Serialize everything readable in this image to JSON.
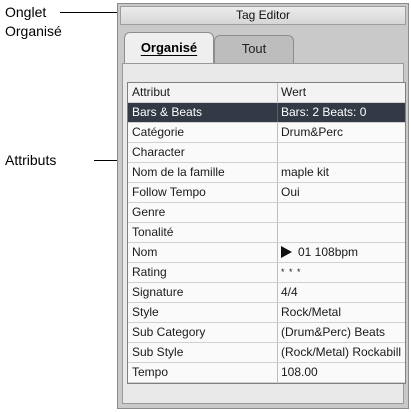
{
  "callouts": {
    "tab_line1": "Onglet",
    "tab_line2": "Organisé",
    "attributes": "Attributs"
  },
  "window": {
    "title": "Tag Editor"
  },
  "tabs": [
    {
      "label": "Organisé",
      "active": true
    },
    {
      "label": "Tout",
      "active": false
    }
  ],
  "table": {
    "headers": [
      "Attribut",
      "Wert"
    ],
    "rows": [
      {
        "attribute": "Bars & Beats",
        "value": "Bars: 2 Beats: 0",
        "selected": true
      },
      {
        "attribute": "Catégorie",
        "value": "Drum&Perc"
      },
      {
        "attribute": "Character",
        "value": ""
      },
      {
        "attribute": "Nom de la famille",
        "value": "maple kit"
      },
      {
        "attribute": "Follow Tempo",
        "value": "Oui"
      },
      {
        "attribute": "Genre",
        "value": ""
      },
      {
        "attribute": "Tonalité",
        "value": ""
      },
      {
        "attribute": "Nom",
        "value": "01 108bpm",
        "icon": "play-icon"
      },
      {
        "attribute": "Rating",
        "value": "* * *"
      },
      {
        "attribute": "Signature",
        "value": "4/4"
      },
      {
        "attribute": "Style",
        "value": "Rock/Metal"
      },
      {
        "attribute": "Sub Category",
        "value": "(Drum&Perc) Beats"
      },
      {
        "attribute": "Sub Style",
        "value": "(Rock/Metal) Rockabill"
      },
      {
        "attribute": "Tempo",
        "value": "108.00"
      }
    ]
  },
  "colors": {
    "selected_row": "#333a45",
    "window_bg": "#c9c9c9"
  }
}
